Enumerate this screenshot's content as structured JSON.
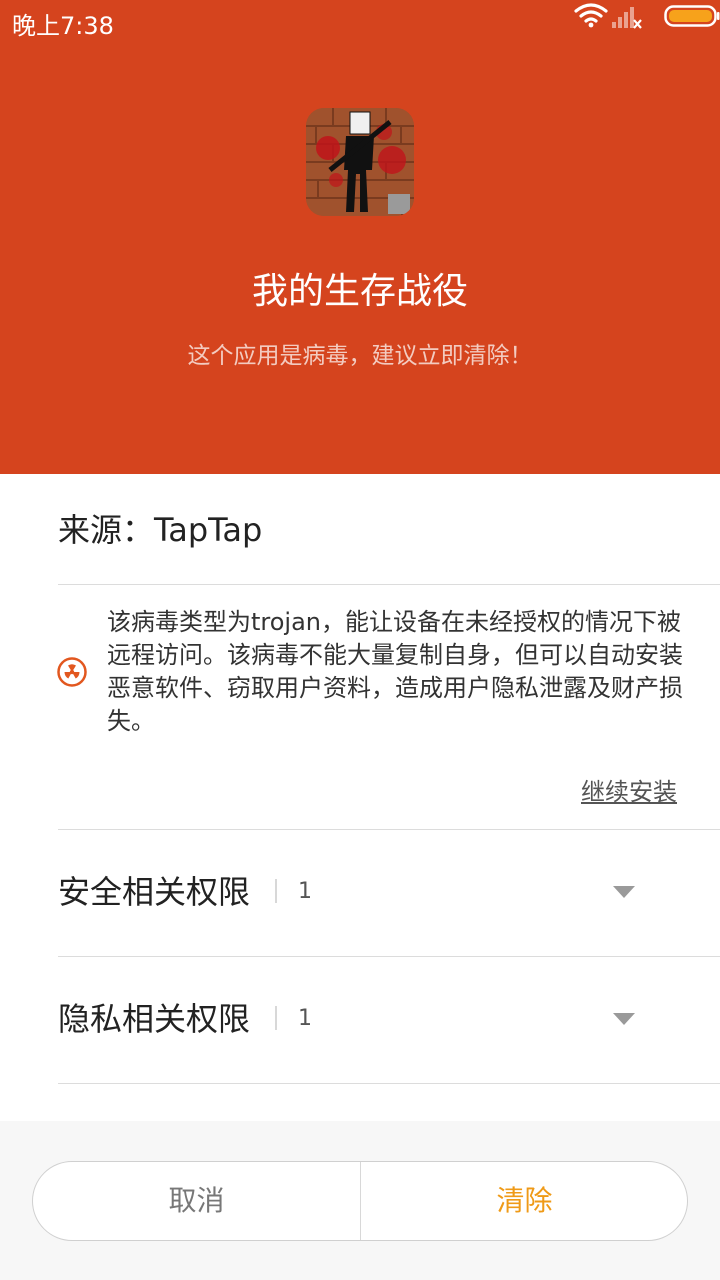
{
  "status_bar": {
    "time": "晚上7:38"
  },
  "header": {
    "app_name": "我的生存战役",
    "warning": "这个应用是病毒，建议立即清除！"
  },
  "source": {
    "text": "来源：TapTap"
  },
  "virus": {
    "description": "该病毒类型为trojan，能让设备在未经授权的情况下被远程访问。该病毒不能大量复制自身，但可以自动安装恶意软件、窃取用户资料，造成用户隐私泄露及财产损失。",
    "continue_install": "继续安装"
  },
  "permissions": [
    {
      "label": "安全相关权限",
      "count": "1"
    },
    {
      "label": "隐私相关权限",
      "count": "1"
    }
  ],
  "buttons": {
    "cancel": "取消",
    "clear": "清除"
  },
  "colors": {
    "header_bg": "#d5441e",
    "accent": "#ef9a17"
  }
}
